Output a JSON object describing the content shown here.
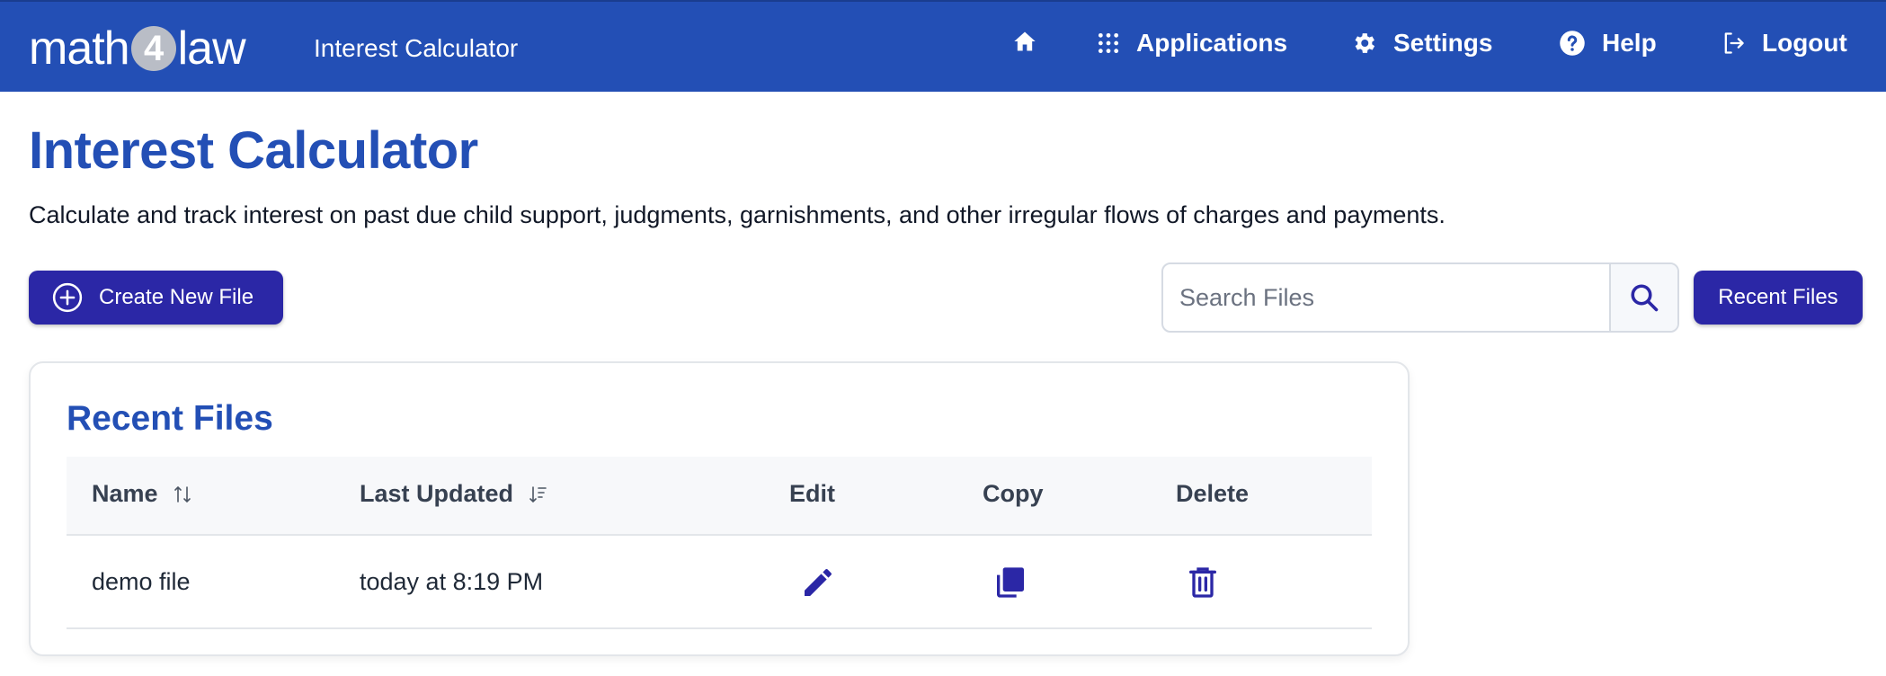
{
  "header": {
    "logo_left": "math",
    "logo_mid": "4",
    "logo_right": "law",
    "app_title": "Interest Calculator",
    "nav": {
      "home_icon": "home-icon",
      "applications": "Applications",
      "settings": "Settings",
      "help": "Help",
      "logout": "Logout"
    }
  },
  "page": {
    "title": "Interest Calculator",
    "subtitle": "Calculate and track interest on past due child support, judgments, garnishments, and other irregular flows of charges and payments."
  },
  "toolbar": {
    "create_label": "Create New File",
    "search_placeholder": "Search Files",
    "recent_label": "Recent Files"
  },
  "recent": {
    "title": "Recent Files",
    "columns": [
      "Name",
      "Last Updated",
      "Edit",
      "Copy",
      "Delete"
    ],
    "rows": [
      {
        "name": "demo file",
        "updated": "today at 8:19 PM"
      }
    ]
  },
  "colors": {
    "header_bg": "#234fb5",
    "primary_button": "#2b27a6",
    "title_blue": "#234fb5",
    "action_icon": "#2b27a6"
  }
}
